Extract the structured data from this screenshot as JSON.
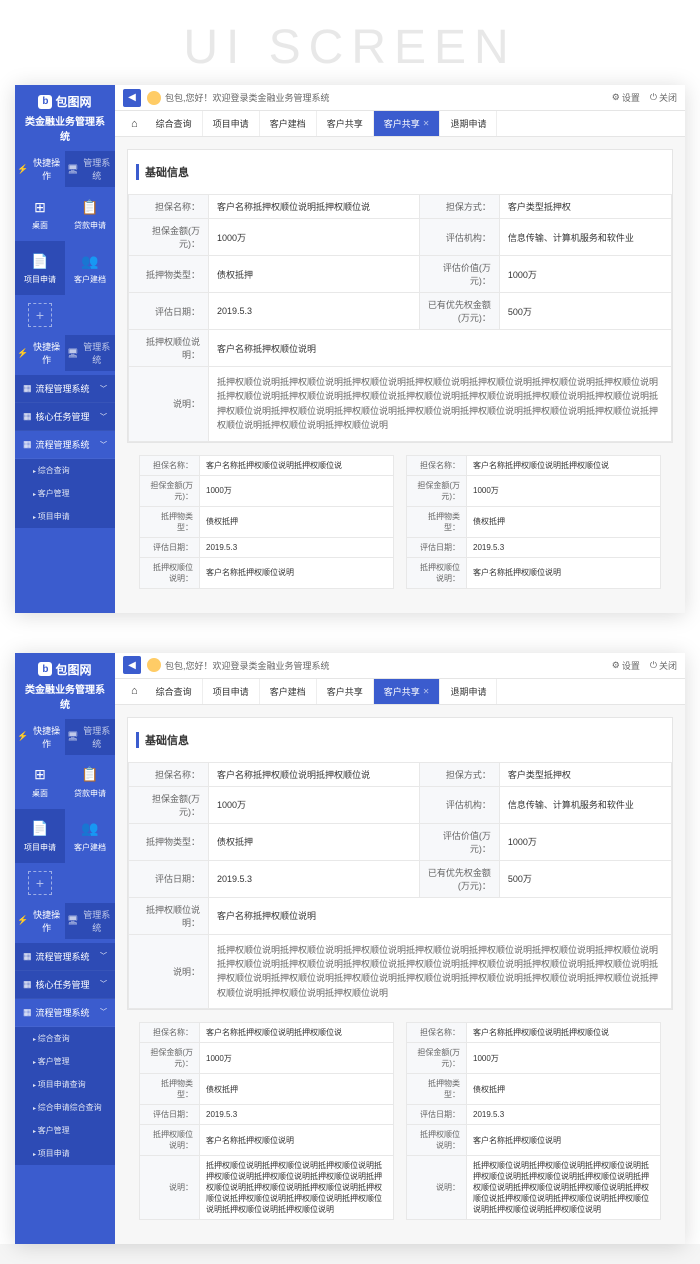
{
  "page_title": "UI SCREEN",
  "brand": {
    "logo_text": "包图网",
    "system_name": "类金融业务管理系统"
  },
  "sidebar_tabs": {
    "quick": "快捷操作",
    "manage": "管理系统"
  },
  "quick_items": [
    {
      "icon": "⊞",
      "label": "桌面"
    },
    {
      "icon": "📋",
      "label": "贷款申请"
    },
    {
      "icon": "📄",
      "label": "项目申请",
      "active": true
    },
    {
      "icon": "👥",
      "label": "客户建档"
    }
  ],
  "menu": {
    "process_mgmt": "流程管理系统",
    "core_task": "核心任务管理",
    "process_sys": "流程管理系统",
    "sub_items": [
      "综合查询",
      "客户管理",
      "项目申请"
    ],
    "sub_items_v2": [
      "综合查询",
      "客户管理",
      "项目申请查询",
      "综合申请综合查询",
      "客户管理",
      "项目申请"
    ]
  },
  "topbar": {
    "welcome": "包包,您好！欢迎登录类金融业务管理系统",
    "settings": "设置",
    "close": "关闭"
  },
  "tabs": [
    "综合查询",
    "项目申请",
    "客户建档",
    "客户共享",
    "客户共享",
    "退期申请"
  ],
  "active_tab_index": 4,
  "section_title": "基础信息",
  "info_rows": [
    {
      "l1": "担保名称：",
      "v1": "客户名称抵押权顺位说明抵押权顺位说",
      "l2": "担保方式：",
      "v2": "客户类型抵押权"
    },
    {
      "l1": "担保金额(万元)：",
      "v1": "1000万",
      "l2": "评估机构：",
      "v2": "信息传输、计算机服务和软件业"
    },
    {
      "l1": "抵押物类型：",
      "v1": "债权抵押",
      "l2": "评估价值(万元)：",
      "v2": "1000万"
    },
    {
      "l1": "评估日期：",
      "v1": "2019.5.3",
      "l2": "已有优先权金额(万元)：",
      "v2": "500万"
    },
    {
      "l1": "抵押权顺位说明：",
      "v1": "客户名称抵押权顺位说明",
      "l2": "",
      "v2": ""
    }
  ],
  "desc_label": "说明：",
  "desc_text": "抵押权顺位说明抵押权顺位说明抵押权顺位说明抵押权顺位说明抵押权顺位说明抵押权顺位说明抵押权顺位说明抵押权顺位说明抵押权顺位说明抵押权顺位说抵押权顺位说明抵押权顺位说明抵押权顺位说明抵押权顺位说明抵押权顺位说明抵押权顺位说明抵押权顺位说明抵押权顺位说明抵押权顺位说明抵押权顺位说明抵押权顺位说抵押权顺位说明抵押权顺位说明抵押权顺位说明",
  "small_table": [
    {
      "l": "担保名称：",
      "v": "客户名称抵押权顺位说明抵押权顺位说"
    },
    {
      "l": "担保金额(万元)：",
      "v": "1000万"
    },
    {
      "l": "抵押物类型：",
      "v": "债权抵押"
    },
    {
      "l": "评估日期：",
      "v": "2019.5.3"
    },
    {
      "l": "抵押权顺位说明：",
      "v": "客户名称抵押权顺位说明"
    }
  ],
  "small_table2": [
    {
      "l": "担保名称：",
      "v": "客户名称抵押权顺位说明抵押权顺位说"
    },
    {
      "l": "担保金额(万元)：",
      "v": "1000万"
    },
    {
      "l": "抵押物类型：",
      "v": "债权抵押"
    },
    {
      "l": "评估日期：",
      "v": "2019.5.3"
    },
    {
      "l": "抵押权顺位说明：",
      "v": "客户名称抵押权顺位说明"
    }
  ],
  "desc_text_v2": "抵押权顺位说明抵押权顺位说明抵押权顺位说明抵押权顺位说明抵押权顺位说明抵押权顺位说明抵押权顺位说明抵押权顺位说明抵押权顺位说明抵押权顺位说抵押权顺位说明抵押权顺位说明抵押权顺位说明抵押权顺位说明抵押权顺位说明"
}
